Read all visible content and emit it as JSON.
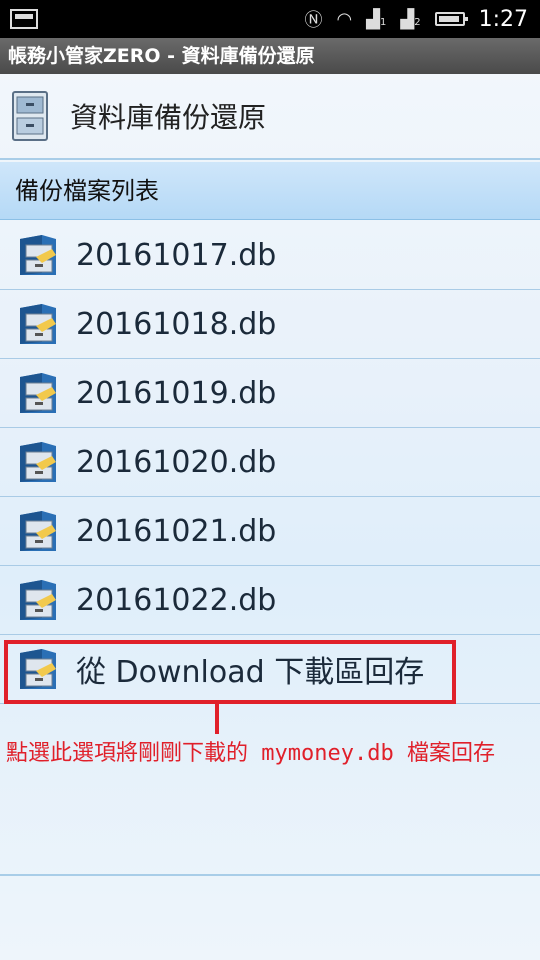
{
  "status_bar": {
    "time": "1:27",
    "signal1": "1",
    "signal2": "2"
  },
  "title_bar": {
    "title": "帳務小管家ZERO - 資料庫備份還原"
  },
  "header": {
    "title": "資料庫備份還原",
    "icon": "file-cabinet-icon"
  },
  "section": {
    "label": "備份檔案列表"
  },
  "files": [
    {
      "label": "20161017.db"
    },
    {
      "label": "20161018.db"
    },
    {
      "label": "20161019.db"
    },
    {
      "label": "20161020.db"
    },
    {
      "label": "20161021.db"
    },
    {
      "label": "20161022.db"
    },
    {
      "label": "從 Download 下載區回存"
    }
  ],
  "annotation": {
    "text": "點選此選項將剛剛下載的 mymoney.db 檔案回存"
  },
  "colors": {
    "highlight": "#e0202a",
    "section_bg": "#b5d9f6",
    "divider": "#a9cbe6"
  }
}
